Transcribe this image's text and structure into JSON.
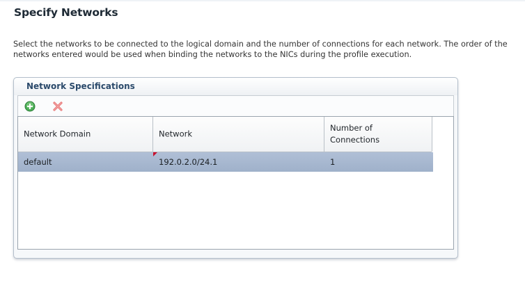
{
  "page": {
    "title": "Specify Networks",
    "description": "Select the networks to be connected to the logical domain and the number of connections for each network. The order of the networks entered would be used when binding the networks to the NICs during the profile execution."
  },
  "panel": {
    "title": "Network Specifications",
    "toolbar": {
      "add_icon": "add-icon",
      "delete_icon": "delete-icon"
    },
    "table": {
      "columns": [
        "Network Domain",
        "Network",
        "Number of Connections"
      ],
      "rows": [
        {
          "network_domain": "default",
          "network": "192.0.2.0/24.1",
          "connections": "1",
          "selected": true
        }
      ]
    }
  },
  "colors": {
    "title": "#1e2a35",
    "panel_title": "#2b4a6b",
    "selected_row": "#a8b8d0",
    "add_icon": "#3fa34d",
    "delete_icon": "#e26161",
    "changed_marker": "#c8102e"
  }
}
